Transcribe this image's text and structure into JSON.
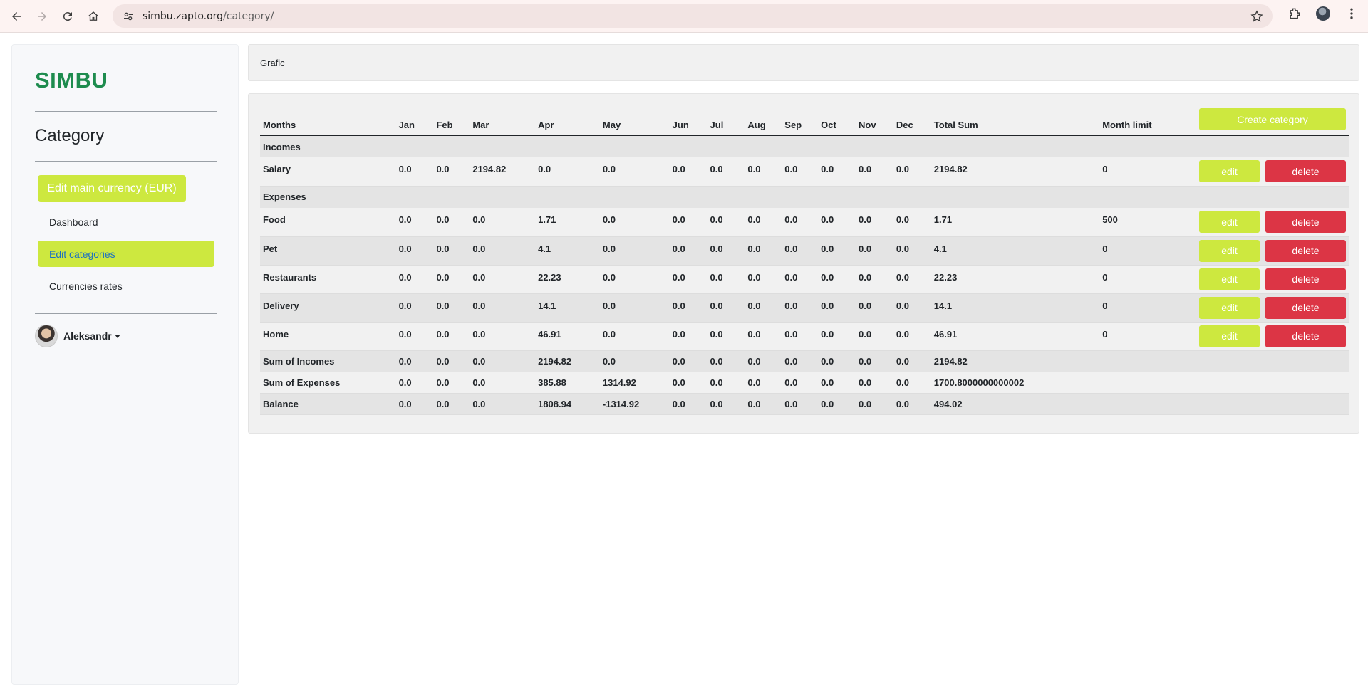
{
  "browser": {
    "url_host": "simbu.zapto.org",
    "url_path": "/category/"
  },
  "sidebar": {
    "logo": "SIMBU",
    "title": "Category",
    "currency_button": "Edit main currency (EUR)",
    "links": [
      {
        "label": "Dashboard",
        "active": false
      },
      {
        "label": "Edit categories",
        "active": true
      },
      {
        "label": "Currencies rates",
        "active": false
      }
    ],
    "user": "Aleksandr"
  },
  "grafic": {
    "label": "Grafic"
  },
  "table": {
    "headers": [
      "Months",
      "Jan",
      "Feb",
      "Mar",
      "Apr",
      "May",
      "Jun",
      "Jul",
      "Aug",
      "Sep",
      "Oct",
      "Nov",
      "Dec",
      "Total Sum",
      "Month limit"
    ],
    "create_button": "Create category",
    "edit_label": "edit",
    "delete_label": "delete",
    "incomes_label": "Incomes",
    "expenses_label": "Expenses",
    "incomes": [
      {
        "name": "Salary",
        "months": [
          "0.0",
          "0.0",
          "2194.82",
          "0.0",
          "0.0",
          "0.0",
          "0.0",
          "0.0",
          "0.0",
          "0.0",
          "0.0",
          "0.0"
        ],
        "total": "2194.82",
        "limit": "0"
      }
    ],
    "expenses": [
      {
        "name": "Food",
        "months": [
          "0.0",
          "0.0",
          "0.0",
          "1.71",
          "0.0",
          "0.0",
          "0.0",
          "0.0",
          "0.0",
          "0.0",
          "0.0",
          "0.0"
        ],
        "total": "1.71",
        "limit": "500"
      },
      {
        "name": "Pet",
        "months": [
          "0.0",
          "0.0",
          "0.0",
          "4.1",
          "0.0",
          "0.0",
          "0.0",
          "0.0",
          "0.0",
          "0.0",
          "0.0",
          "0.0"
        ],
        "total": "4.1",
        "limit": "0"
      },
      {
        "name": "Restaurants",
        "months": [
          "0.0",
          "0.0",
          "0.0",
          "22.23",
          "0.0",
          "0.0",
          "0.0",
          "0.0",
          "0.0",
          "0.0",
          "0.0",
          "0.0"
        ],
        "total": "22.23",
        "limit": "0"
      },
      {
        "name": "Delivery",
        "months": [
          "0.0",
          "0.0",
          "0.0",
          "14.1",
          "0.0",
          "0.0",
          "0.0",
          "0.0",
          "0.0",
          "0.0",
          "0.0",
          "0.0"
        ],
        "total": "14.1",
        "limit": "0"
      },
      {
        "name": "Home",
        "months": [
          "0.0",
          "0.0",
          "0.0",
          "46.91",
          "0.0",
          "0.0",
          "0.0",
          "0.0",
          "0.0",
          "0.0",
          "0.0",
          "0.0"
        ],
        "total": "46.91",
        "limit": "0"
      }
    ],
    "summary": [
      {
        "name": "Sum of Incomes",
        "months": [
          "0.0",
          "0.0",
          "0.0",
          "2194.82",
          "0.0",
          "0.0",
          "0.0",
          "0.0",
          "0.0",
          "0.0",
          "0.0",
          "0.0"
        ],
        "total": "2194.82"
      },
      {
        "name": "Sum of Expenses",
        "months": [
          "0.0",
          "0.0",
          "0.0",
          "385.88",
          "1314.92",
          "0.0",
          "0.0",
          "0.0",
          "0.0",
          "0.0",
          "0.0",
          "0.0"
        ],
        "total": "1700.8000000000002"
      },
      {
        "name": "Balance",
        "months": [
          "0.0",
          "0.0",
          "0.0",
          "1808.94",
          "-1314.92",
          "0.0",
          "0.0",
          "0.0",
          "0.0",
          "0.0",
          "0.0",
          "0.0"
        ],
        "total": "494.02"
      }
    ]
  },
  "colors": {
    "accent": "#cde83f",
    "danger": "#dc3545",
    "logo": "#1e8c4e",
    "active_link": "#1a6fc4"
  }
}
